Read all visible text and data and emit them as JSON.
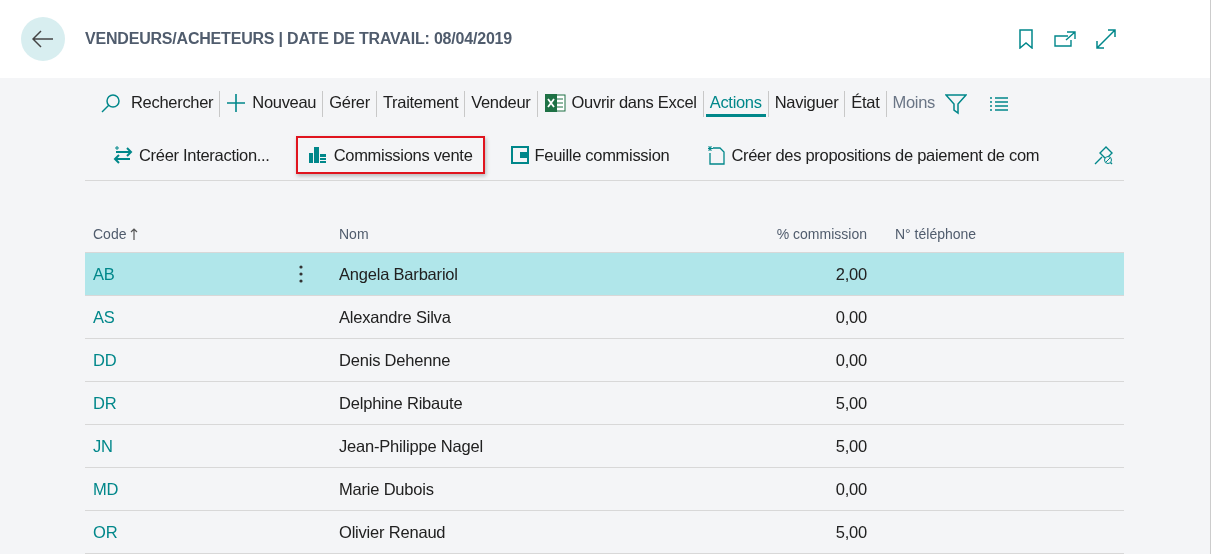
{
  "header": {
    "title": "VENDEURS/ACHETEURS | DATE DE TRAVAIL: 08/04/2019"
  },
  "menu": [
    {
      "kind": "search",
      "label": "Rechercher",
      "selected": false
    },
    {
      "kind": "new",
      "label": "Nouveau",
      "selected": false
    },
    {
      "kind": "plain",
      "label": "Gérer",
      "selected": false
    },
    {
      "kind": "plain",
      "label": "Traitement",
      "selected": false
    },
    {
      "kind": "plain",
      "label": "Vendeur",
      "selected": false
    },
    {
      "kind": "excel",
      "label": "Ouvrir dans Excel",
      "selected": false
    },
    {
      "kind": "plain",
      "label": "Actions",
      "selected": true
    },
    {
      "kind": "plain",
      "label": "Naviguer",
      "selected": false
    },
    {
      "kind": "plain",
      "label": "État",
      "selected": false
    },
    {
      "kind": "more",
      "label": "Moins",
      "selected": false
    }
  ],
  "actions": [
    {
      "kind": "interaction",
      "label": "Créer Interaction...",
      "highlighted": false
    },
    {
      "kind": "commission",
      "label": "Commissions vente",
      "highlighted": true
    },
    {
      "kind": "sheet",
      "label": "Feuille commission",
      "highlighted": false
    },
    {
      "kind": "newdoc",
      "label": "Créer des propositions de paiement de com",
      "highlighted": false
    }
  ],
  "table": {
    "columns": [
      "Code",
      "Nom",
      "% commission",
      "N° téléphone"
    ],
    "rows": [
      {
        "code": "AB",
        "name": "Angela Barbariol",
        "commission": "2,00",
        "selected": true
      },
      {
        "code": "AS",
        "name": "Alexandre Silva",
        "commission": "0,00",
        "selected": false
      },
      {
        "code": "DD",
        "name": "Denis Dehenne",
        "commission": "0,00",
        "selected": false
      },
      {
        "code": "DR",
        "name": "Delphine Ribaute",
        "commission": "5,00",
        "selected": false
      },
      {
        "code": "JN",
        "name": "Jean-Philippe Nagel",
        "commission": "5,00",
        "selected": false
      },
      {
        "code": "MD",
        "name": "Marie Dubois",
        "commission": "0,00",
        "selected": false
      },
      {
        "code": "OR",
        "name": "Olivier Renaud",
        "commission": "5,00",
        "selected": false
      }
    ]
  }
}
